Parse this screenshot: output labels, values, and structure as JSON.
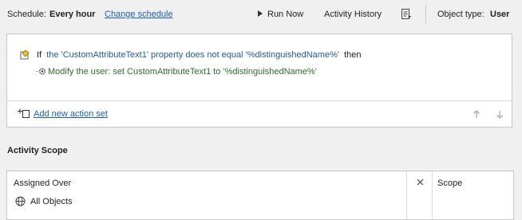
{
  "toolbar": {
    "schedule_label": "Schedule:",
    "schedule_value": "Every hour",
    "change_schedule_link": "Change schedule",
    "run_now_label": "Run Now",
    "activity_history_label": "Activity History",
    "object_type_label": "Object type:",
    "object_type_value": "User"
  },
  "rule": {
    "if_keyword": "If",
    "condition": "the 'CustomAttributeText1' property does not equal '%distinguishedName%'",
    "then_keyword": "then",
    "action": "Modify the user: set CustomAttributeText1 to '%distinguishedName%'",
    "add_action_set_link": "Add new action set"
  },
  "scope": {
    "section_title": "Activity Scope",
    "columns": [
      "Assigned Over",
      "Scope"
    ],
    "rows": [
      {
        "assigned_over": "All Objects"
      }
    ]
  },
  "colors": {
    "link": "#1a5fb4",
    "condition_text": "#1f5aa8",
    "action_text": "#2c6e2c"
  },
  "icons": [
    "play-icon",
    "document-list-icon",
    "condition-icon",
    "gear-icon",
    "add-action-set-icon",
    "arrow-up-icon",
    "arrow-down-icon",
    "close-icon",
    "globe-icon"
  ]
}
